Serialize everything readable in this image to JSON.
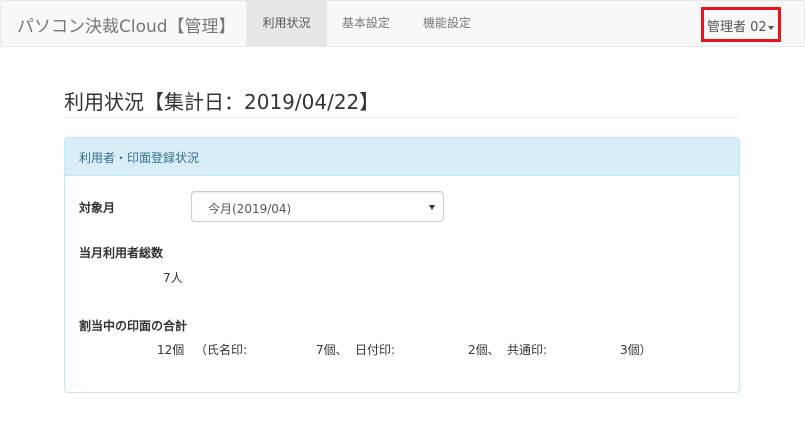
{
  "navbar": {
    "brand": "パソコン決裁Cloud【管理】",
    "items": [
      {
        "label": "利用状況",
        "active": true
      },
      {
        "label": "基本設定",
        "active": false
      },
      {
        "label": "機能設定",
        "active": false
      }
    ],
    "user": {
      "label": "管理者 02"
    }
  },
  "page": {
    "title": "利用状況【集計日：2019/04/22】"
  },
  "panel": {
    "heading": "利用者・印面登録状況",
    "month": {
      "label": "対象月",
      "selected": "今月(2019/04)"
    },
    "users": {
      "label": "当月利用者総数",
      "value": "7人"
    },
    "stamps": {
      "label": "割当中の印面の合計",
      "total": "12個",
      "name_label": "（氏名印:",
      "name_value": "7個、",
      "date_label": "日付印:",
      "date_value": "2個、",
      "common_label": "共通印:",
      "common_value": "3個）"
    }
  },
  "colors": {
    "navbar_bg": "#f8f8f8",
    "active_tab_bg": "#e7e7e7",
    "highlight_border": "#e8141b",
    "panel_heading_bg": "#d9edf7",
    "panel_heading_text": "#31708f",
    "panel_border": "#bce8f1"
  }
}
